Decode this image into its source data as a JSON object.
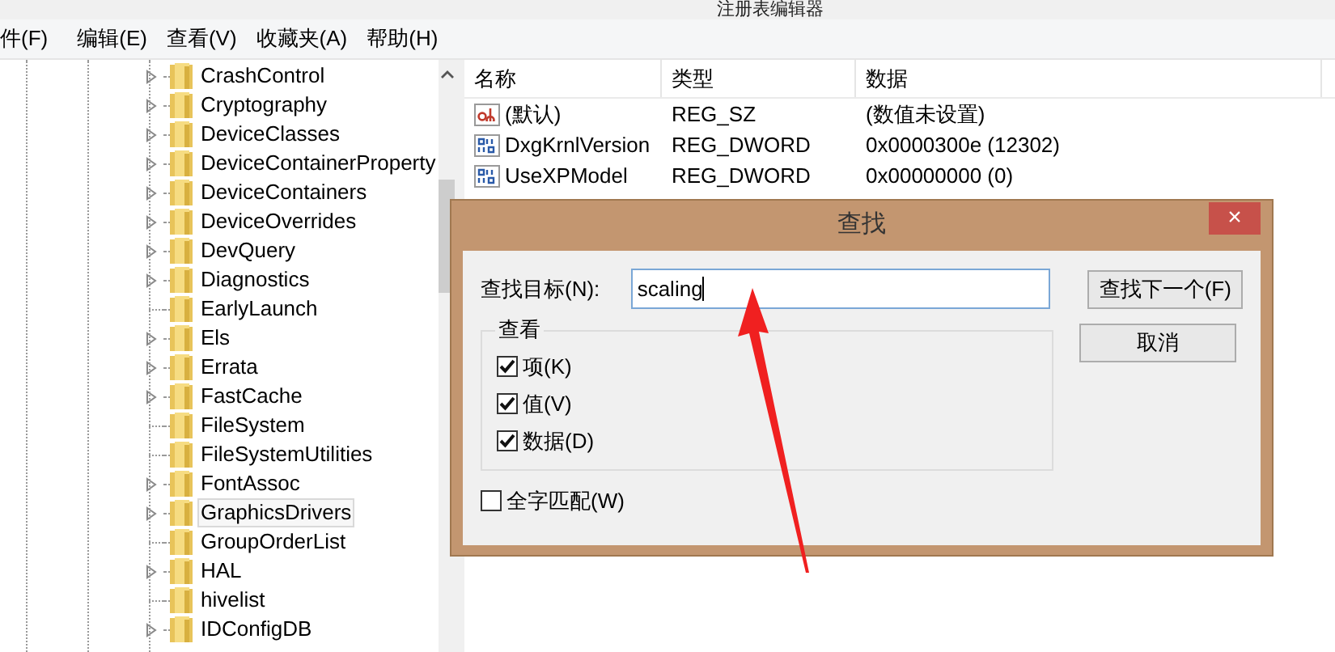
{
  "window": {
    "title": "注册表编辑器"
  },
  "menu": [
    "件(F)",
    "编辑(E)",
    "查看(V)",
    "收藏夹(A)",
    "帮助(H)"
  ],
  "tree": {
    "items": [
      {
        "label": "CrashControl",
        "expandable": true,
        "selected": false
      },
      {
        "label": "Cryptography",
        "expandable": true,
        "selected": false
      },
      {
        "label": "DeviceClasses",
        "expandable": true,
        "selected": false
      },
      {
        "label": "DeviceContainerProperty",
        "expandable": true,
        "selected": false
      },
      {
        "label": "DeviceContainers",
        "expandable": true,
        "selected": false
      },
      {
        "label": "DeviceOverrides",
        "expandable": true,
        "selected": false
      },
      {
        "label": "DevQuery",
        "expandable": true,
        "selected": false
      },
      {
        "label": "Diagnostics",
        "expandable": true,
        "selected": false
      },
      {
        "label": "EarlyLaunch",
        "expandable": false,
        "selected": false
      },
      {
        "label": "Els",
        "expandable": true,
        "selected": false
      },
      {
        "label": "Errata",
        "expandable": true,
        "selected": false
      },
      {
        "label": "FastCache",
        "expandable": true,
        "selected": false
      },
      {
        "label": "FileSystem",
        "expandable": false,
        "selected": false
      },
      {
        "label": "FileSystemUtilities",
        "expandable": false,
        "selected": false
      },
      {
        "label": "FontAssoc",
        "expandable": true,
        "selected": false
      },
      {
        "label": "GraphicsDrivers",
        "expandable": true,
        "selected": true
      },
      {
        "label": "GroupOrderList",
        "expandable": false,
        "selected": false
      },
      {
        "label": "HAL",
        "expandable": true,
        "selected": false
      },
      {
        "label": "hivelist",
        "expandable": false,
        "selected": false
      },
      {
        "label": "IDConfigDB",
        "expandable": true,
        "selected": false
      }
    ]
  },
  "values": {
    "columns": [
      "名称",
      "类型",
      "数据"
    ],
    "rows": [
      {
        "kind": "string",
        "name": "(默认)",
        "type": "REG_SZ",
        "data": "(数值未设置)"
      },
      {
        "kind": "binary",
        "name": "DxgKrnlVersion",
        "type": "REG_DWORD",
        "data": "0x0000300e (12302)"
      },
      {
        "kind": "binary",
        "name": "UseXPModel",
        "type": "REG_DWORD",
        "data": "0x00000000 (0)"
      }
    ]
  },
  "dialog": {
    "title": "查找",
    "close": "×",
    "target_label": "查找目标(N):",
    "target_value": "scaling",
    "buttons": [
      "查找下一个(F)",
      "取消"
    ],
    "group_title": "查看",
    "options": [
      {
        "label": "项(K)",
        "checked": true
      },
      {
        "label": "值(V)",
        "checked": true
      },
      {
        "label": "数据(D)",
        "checked": true
      }
    ],
    "whole_word": {
      "label": "全字匹配(W)",
      "checked": false
    }
  }
}
